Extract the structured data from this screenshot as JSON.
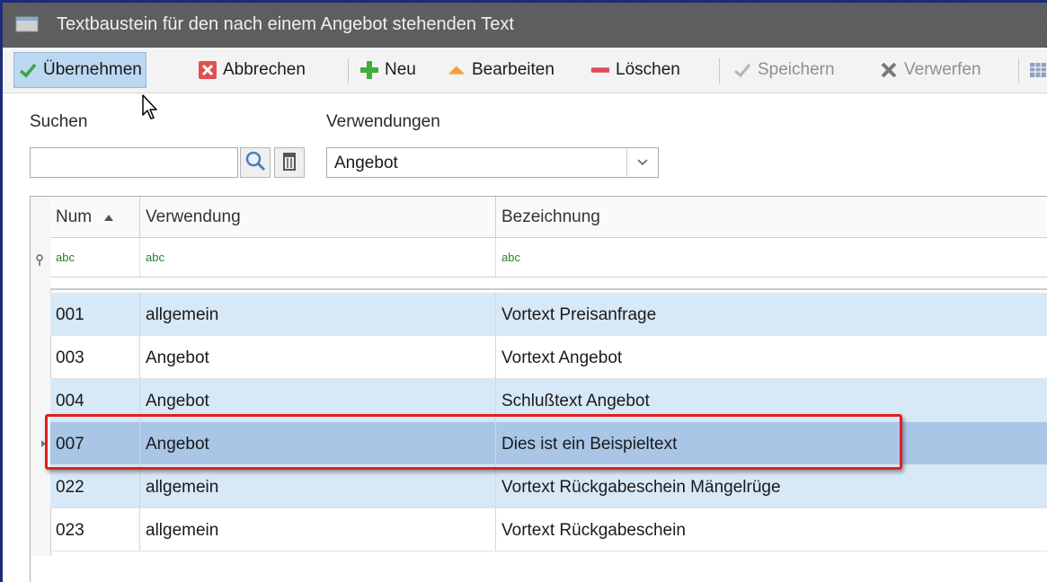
{
  "window": {
    "title": "Textbaustein für den nach einem Angebot stehenden Text"
  },
  "toolbar": {
    "uebernehmen": "Übernehmen",
    "abbrechen": "Abbrechen",
    "neu": "Neu",
    "bearbeiten": "Bearbeiten",
    "loeschen": "Löschen",
    "speichern": "Speichern",
    "verwerfen": "Verwerfen"
  },
  "filters": {
    "search_label": "Suchen",
    "search_value": "",
    "usage_label": "Verwendungen",
    "usage_value": "Angebot"
  },
  "grid": {
    "columns": [
      "Num",
      "Verwendung",
      "Bezeichnung"
    ],
    "filter_hint": "abc",
    "rows": [
      {
        "num": "001",
        "verwendung": "allgemein",
        "bezeichnung": "Vortext Preisanfrage"
      },
      {
        "num": "003",
        "verwendung": "Angebot",
        "bezeichnung": "Vortext Angebot"
      },
      {
        "num": "004",
        "verwendung": "Angebot",
        "bezeichnung": "Schlußtext Angebot"
      },
      {
        "num": "007",
        "verwendung": "Angebot",
        "bezeichnung": "Dies ist ein Beispieltext"
      },
      {
        "num": "022",
        "verwendung": "allgemein",
        "bezeichnung": "Vortext Rückgabeschein Mängelrüge"
      },
      {
        "num": "023",
        "verwendung": "allgemein",
        "bezeichnung": "Vortext Rückgabeschein"
      }
    ]
  },
  "colors": {
    "titlebar": "#5b5b5b",
    "row_alt": "#d7e8f7",
    "row_selected": "#a9c6e6",
    "highlight": "#e02020"
  }
}
